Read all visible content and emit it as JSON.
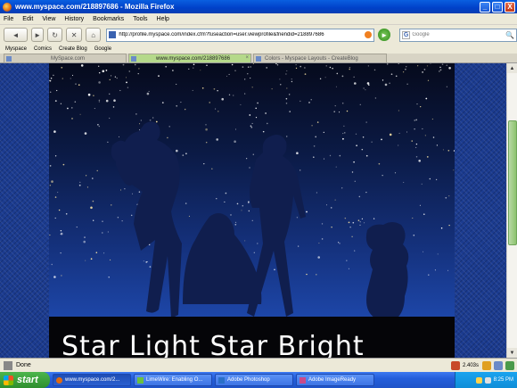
{
  "window": {
    "title": "www.myspace.com/218897686 - Mozilla Firefox",
    "minimize": "_",
    "maximize": "□",
    "close": "X"
  },
  "menu": [
    "File",
    "Edit",
    "View",
    "History",
    "Bookmarks",
    "Tools",
    "Help"
  ],
  "nav": {
    "back": "◄",
    "forward": "►",
    "reload": "↻",
    "stop": "✕",
    "home": "⌂",
    "url": "http://profile.myspace.com/index.cfm?fuseaction=user.viewprofile&friendid=218897686",
    "go": "►",
    "search_engine": "G",
    "search_placeholder": "Google",
    "search_glyph": "🔍"
  },
  "bookmarks": [
    "Myspace",
    "Comics",
    "Create Blog",
    "Google"
  ],
  "tabs": [
    {
      "label": "MySpace.com",
      "active": false
    },
    {
      "label": "www.myspace.com/218897686",
      "active": true
    },
    {
      "label": "Colors - Myspace Layouts - CreateBlog",
      "active": false
    }
  ],
  "tab_close": "×",
  "banner": {
    "text": "Star Light Star Bright"
  },
  "status": {
    "text": "Done",
    "speed": "2.403s"
  },
  "taskbar": {
    "start": "start",
    "tasks": [
      {
        "label": "www.myspace.com/2...",
        "active": true,
        "color": "#e06a10"
      },
      {
        "label": "LimeWire: Enabling O...",
        "active": false,
        "color": "#6ac040"
      },
      {
        "label": "Adobe Photoshop",
        "active": false,
        "color": "#2a70c8"
      },
      {
        "label": "Adobe ImageReady",
        "active": false,
        "color": "#c84a8a"
      }
    ],
    "clock": "8:25 PM"
  },
  "colors": {
    "accent": "#245edb",
    "page_bg": "#1b3b8f",
    "scroll_thumb": "#8cc36e"
  }
}
